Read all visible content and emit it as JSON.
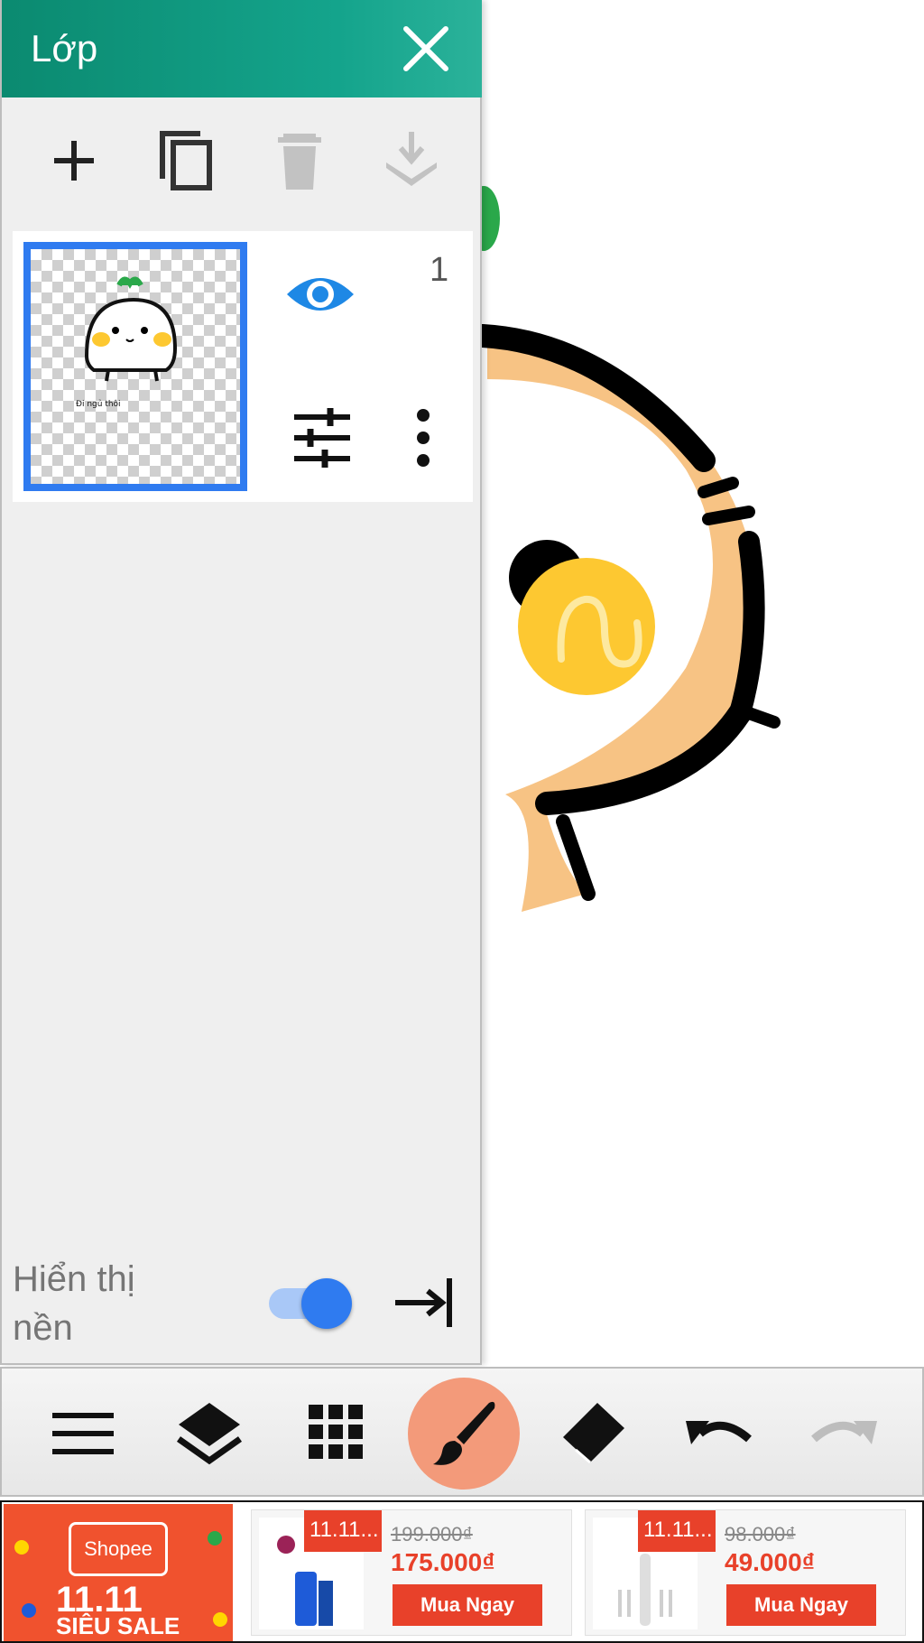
{
  "layers_panel": {
    "title": "Lớp",
    "tools": {
      "add_icon": "plus-icon",
      "duplicate_icon": "copy-icon",
      "delete_icon": "trash-icon",
      "merge_down_icon": "merge-down-icon"
    },
    "layers": [
      {
        "number": "1",
        "visible": true,
        "thumbnail_caption": "Đi ngủ thôi",
        "selected": true
      }
    ],
    "background_label": "Hiển thị nền",
    "background_toggle_on": true
  },
  "toolbar": {
    "items": [
      "menu-icon",
      "layers-icon",
      "grid-icon",
      "brush-icon",
      "eraser-icon",
      "undo-icon",
      "redo-icon"
    ],
    "active": "brush-icon"
  },
  "ad": {
    "banner_brand": "Shopee",
    "banner_event": "11.11",
    "banner_tagline": "SIÊU SALE",
    "products": [
      {
        "tag": "11.11...",
        "old_price": "199.000₫",
        "new_price": "175.000₫",
        "button": "Mua Ngay"
      },
      {
        "tag": "11.11...",
        "old_price": "98.000₫",
        "new_price": "49.000₫",
        "button": "Mua Ngay"
      }
    ]
  },
  "colors": {
    "header": "#14a48c",
    "accent_blue": "#2f7bf0",
    "active_tool": "#f39a7a",
    "ad_orange": "#e8412a"
  }
}
